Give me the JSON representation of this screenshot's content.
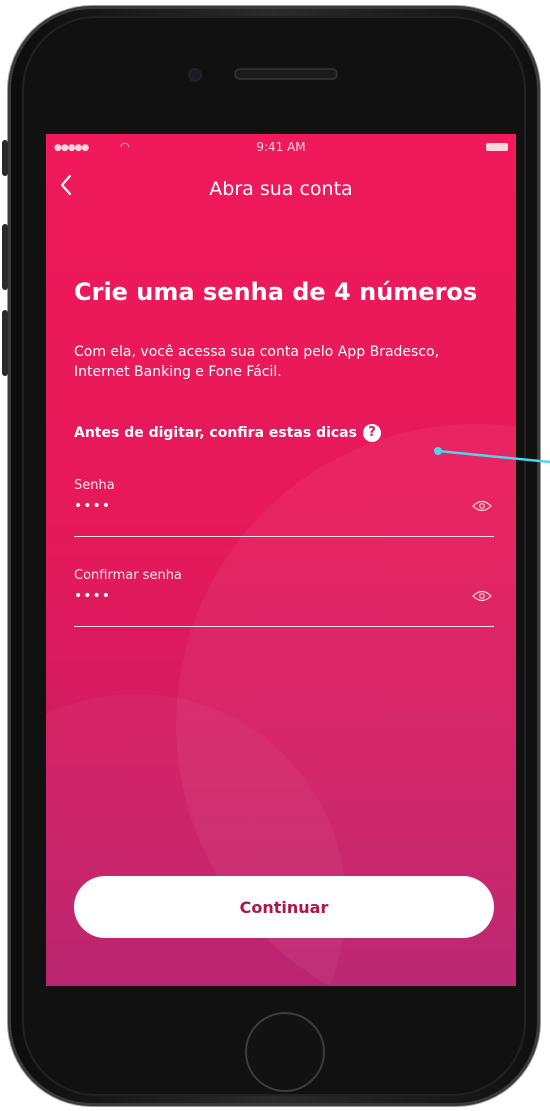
{
  "status": {
    "time": "9:41 AM"
  },
  "nav": {
    "back_icon": "chevron-left-icon",
    "title": "Abra sua conta"
  },
  "main": {
    "heading": "Crie uma senha de 4 números",
    "description": "Com ela, você acessa sua conta pelo App Bradesco, Internet Banking e Fone Fácil.",
    "tips_label": "Antes de digitar, confira estas dicas",
    "help_icon": "?"
  },
  "fields": [
    {
      "label": "Senha",
      "value": "••••"
    },
    {
      "label": "Confirmar senha",
      "value": "••••"
    }
  ],
  "actions": {
    "continue_label": "Continuar"
  },
  "colors": {
    "accent": "#e6195a",
    "annotation": "#4fd3f0"
  }
}
